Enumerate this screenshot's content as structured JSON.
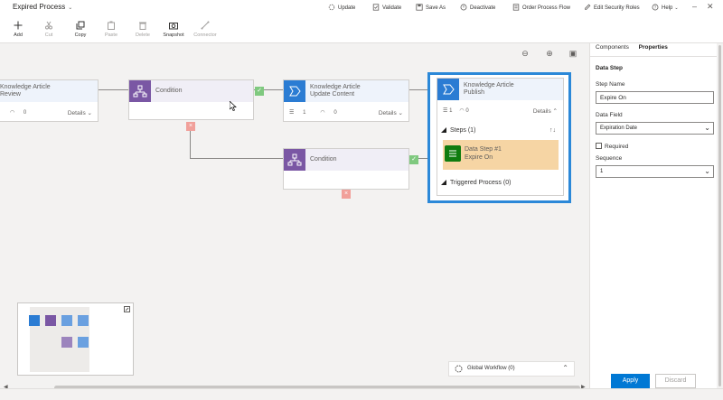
{
  "app": {
    "title": "Expired Process"
  },
  "commands": [
    {
      "label": "Update",
      "icon": "update-icon"
    },
    {
      "label": "Validate",
      "icon": "validate-icon"
    },
    {
      "label": "Save As",
      "icon": "save-as-icon"
    },
    {
      "label": "Deactivate",
      "icon": "deactivate-icon"
    },
    {
      "label": "Order Process Flow",
      "icon": "order-process-flow-icon"
    },
    {
      "label": "Edit Security Roles",
      "icon": "edit-security-roles-icon"
    },
    {
      "label": "Help",
      "icon": "help-icon"
    }
  ],
  "tools": [
    {
      "label": "Add",
      "icon": "plus-icon"
    },
    {
      "label": "Cut",
      "icon": "scissors-icon"
    },
    {
      "label": "Copy",
      "icon": "copy-icon"
    },
    {
      "label": "Paste",
      "icon": "paste-icon"
    },
    {
      "label": "Delete",
      "icon": "trash-icon"
    },
    {
      "label": "Snapshot",
      "icon": "camera-icon"
    },
    {
      "label": "Connector",
      "icon": "connector-icon"
    }
  ],
  "canvas": {
    "node_review": {
      "title": "Knowledge Article",
      "title2": "Review",
      "count": "0",
      "details": "Details"
    },
    "node_cond1": {
      "title": "Condition"
    },
    "node_update": {
      "title": "Knowledge Article",
      "title2": "Update Content",
      "count1": "1",
      "count2": "0",
      "details": "Details"
    },
    "node_cond2": {
      "title": "Condition"
    },
    "node_publish": {
      "title": "Knowledge Article",
      "title2": "Publish",
      "count1": "1",
      "count2": "0",
      "details": "Details",
      "steps": "Steps (1)",
      "datastep_title": "Data Step #1",
      "datastep_sub": "Expire On",
      "triggered": "Triggered Process (0)"
    },
    "global_workflow": "Global Workflow (0)"
  },
  "panel": {
    "tab_components": "Components",
    "tab_properties": "Properties",
    "section": "Data Step",
    "step_name_label": "Step Name",
    "step_name_value": "Expire On",
    "data_field_label": "Data Field",
    "data_field_value": "Expiration Date",
    "required_label": "Required",
    "sequence_label": "Sequence",
    "sequence_value": "1",
    "apply": "Apply",
    "discard": "Discard"
  },
  "colors": {
    "accent": "#0078d4",
    "selection": "#2b88d8",
    "stage_blue": "#2b7cd3",
    "condition_purple": "#7a57a4",
    "data_step_bg": "#f6d5a4",
    "data_step_icon": "#107c10",
    "check_green": "#7fc97f",
    "delete_red": "#f1a09a"
  }
}
